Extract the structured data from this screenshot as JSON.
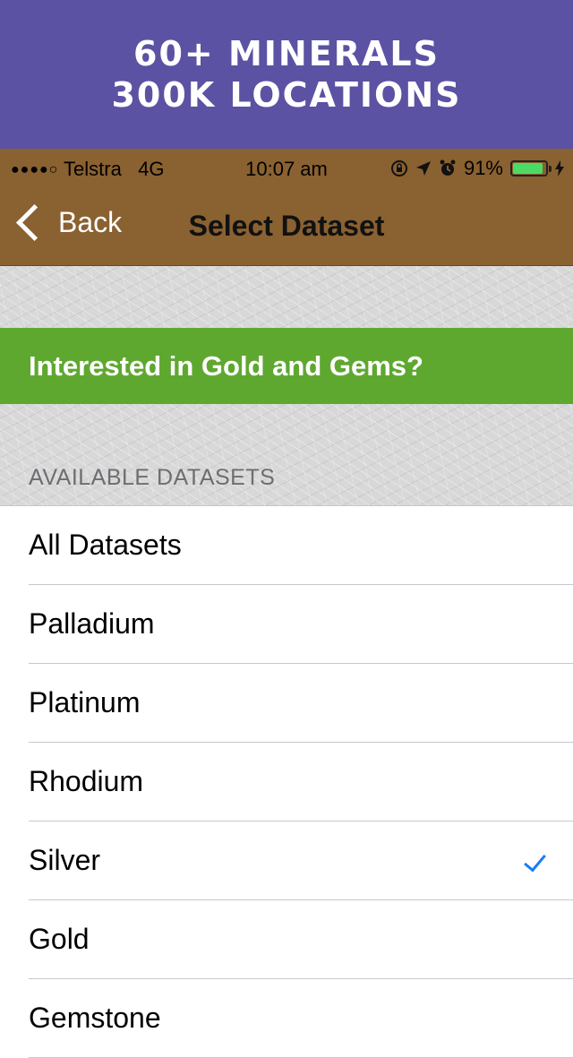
{
  "promo": {
    "line1": "60+ MINERALS",
    "line2": "300K LOCATIONS"
  },
  "status_bar": {
    "signal": "●●●●○",
    "carrier": "Telstra",
    "network": "4G",
    "time": "10:07 am",
    "icons": [
      "rotation-lock-icon",
      "location-arrow-icon",
      "alarm-icon"
    ],
    "battery_percent_text": "91%",
    "battery_level": 0.91,
    "battery_color": "#4cd964"
  },
  "nav_bar": {
    "back_label": "Back",
    "title": "Select Dataset",
    "color": "#8a6130"
  },
  "banner": {
    "text": "Interested in Gold and Gems?",
    "color": "#5fa830"
  },
  "section": {
    "header": "AVAILABLE DATASETS"
  },
  "datasets": [
    {
      "label": "All Datasets",
      "selected": false
    },
    {
      "label": "Palladium",
      "selected": false
    },
    {
      "label": "Platinum",
      "selected": false
    },
    {
      "label": "Rhodium",
      "selected": false
    },
    {
      "label": "Silver",
      "selected": true
    },
    {
      "label": "Gold",
      "selected": false
    },
    {
      "label": "Gemstone",
      "selected": false
    }
  ],
  "accent_color": "#1a7cf5"
}
